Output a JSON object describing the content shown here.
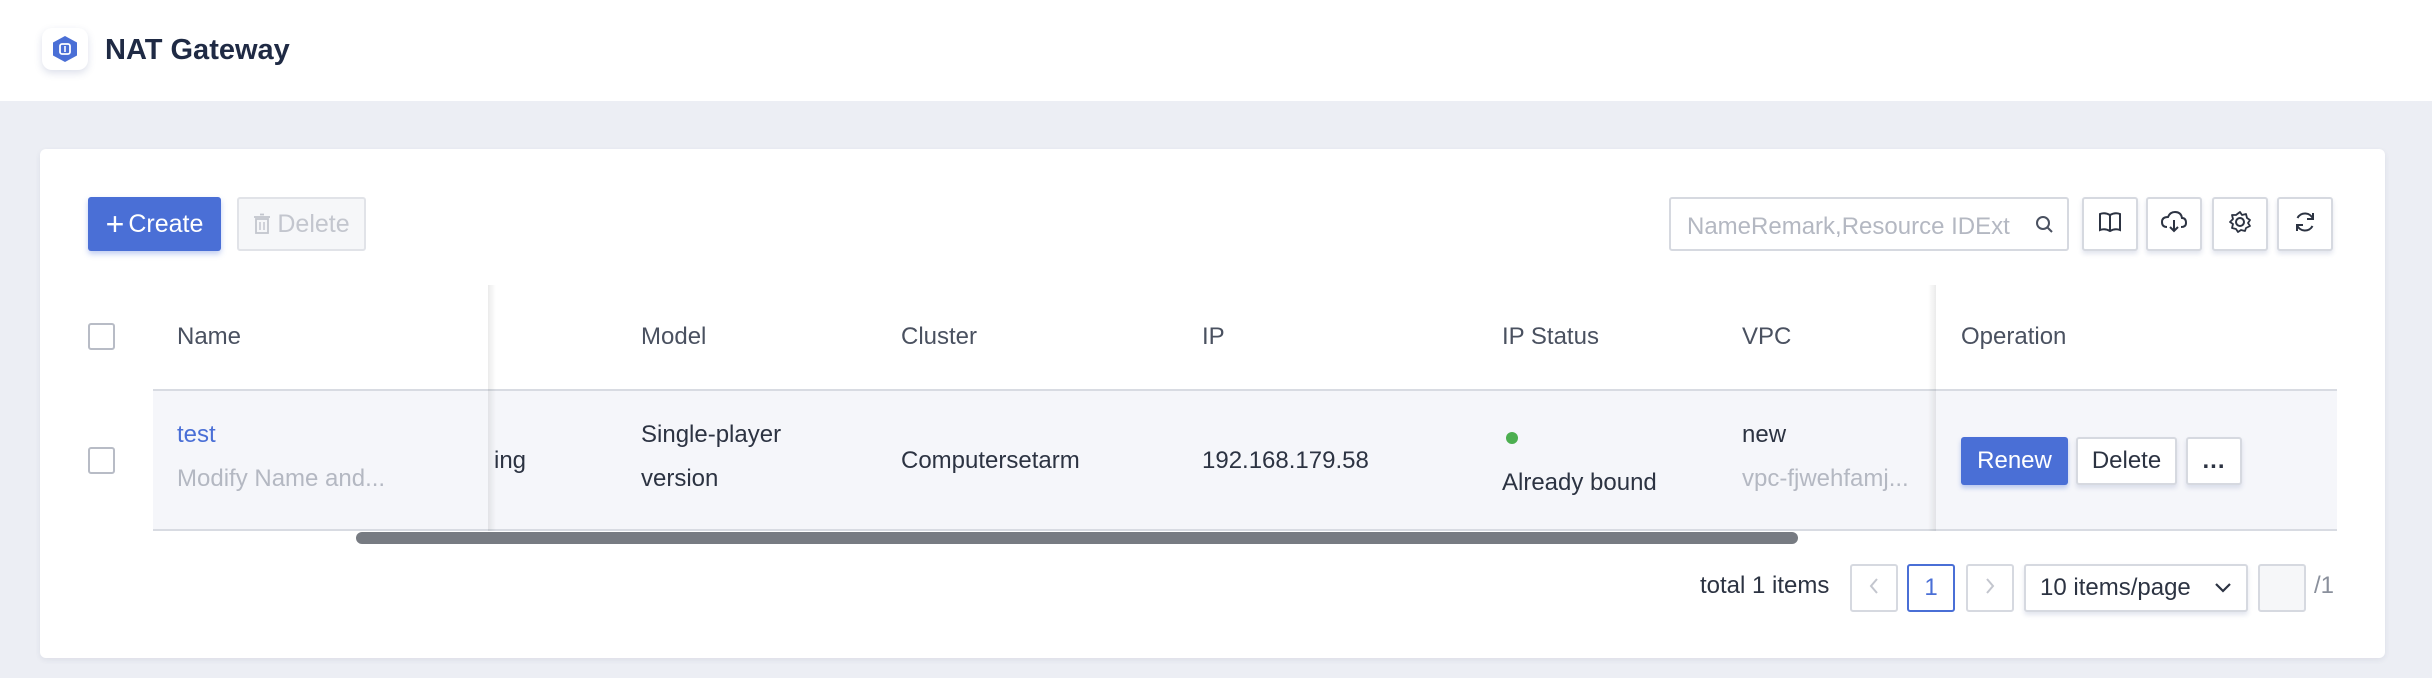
{
  "header": {
    "title": "NAT Gateway",
    "logo_icon": "nat-gateway-logo-icon"
  },
  "toolbar": {
    "create_label": "Create",
    "delete_label": "Delete",
    "search_placeholder": "NameRemark,Resource IDExt",
    "icons": [
      "book-icon",
      "cloud-download-icon",
      "gear-icon",
      "refresh-icon"
    ]
  },
  "table": {
    "columns": {
      "name": "Name",
      "model": "Model",
      "cluster": "Cluster",
      "ip": "IP",
      "ip_status": "IP Status",
      "vpc": "VPC",
      "operation": "Operation"
    },
    "rows": [
      {
        "name": "test",
        "name_sub": "Modify Name and...",
        "status_partial": "ing",
        "model_line1": "Single-player",
        "model_line2": "version",
        "cluster": "Computersetarm",
        "ip": "192.168.179.58",
        "ip_status": "Already bound",
        "vpc": "new",
        "vpc_sub": "vpc-fjwehfamj...",
        "actions": {
          "renew": "Renew",
          "delete": "Delete",
          "more": "..."
        }
      }
    ]
  },
  "pagination": {
    "total_label": "total 1 items",
    "current_page": "1",
    "page_size": "10 items/page",
    "total_pages": "/1"
  },
  "colors": {
    "accent": "#4a6fd6",
    "status_ok": "#4caf50"
  }
}
